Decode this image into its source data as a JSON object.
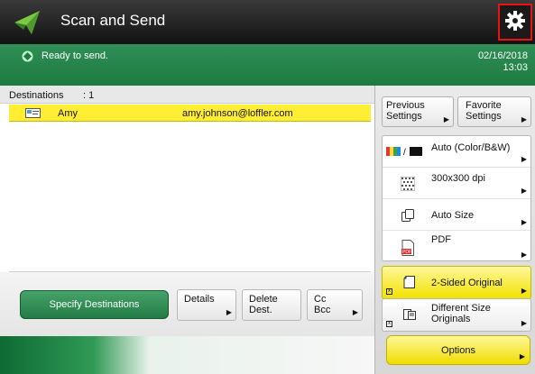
{
  "app": {
    "title": "Scan and Send",
    "icon": "paper-plane-icon",
    "settings_icon": "gear-icon"
  },
  "status": {
    "text": "Ready to send.",
    "date": "02/16/2018",
    "time": "13:03",
    "icon": "status-diamond-icon"
  },
  "destinations": {
    "header_label": "Destinations",
    "count_label": ": 1",
    "rows": [
      {
        "name": "Amy",
        "email": "amy.johnson@loffler.com",
        "icon": "address-card-icon"
      }
    ]
  },
  "bottom_buttons": {
    "specify": "Specify Destinations",
    "details": "Details",
    "delete_line1": "Delete",
    "delete_line2": "Dest.",
    "cc_line1": "Cc",
    "cc_line2": "Bcc"
  },
  "right_panel": {
    "previous_line1": "Previous",
    "previous_line2": "Settings",
    "favorite_line1": "Favorite",
    "favorite_line2": "Settings",
    "settings": [
      {
        "label": "Auto (Color/B&W)",
        "icon": "color-mode-icon"
      },
      {
        "label": "300x300 dpi",
        "icon": "resolution-icon"
      },
      {
        "label": "Auto Size",
        "icon": "size-icon"
      },
      {
        "label": "PDF",
        "icon": "pdf-file-icon"
      }
    ],
    "two_sided": {
      "label": "2-Sided Original",
      "icon": "two-sided-icon"
    },
    "different_size": {
      "line1": "Different Size",
      "line2": "Originals",
      "icon": "different-size-icon"
    },
    "options": "Options"
  },
  "colors": {
    "status_green": "#2a8a4f",
    "highlight_yellow": "#ffee33",
    "alert_red": "#e11111"
  }
}
